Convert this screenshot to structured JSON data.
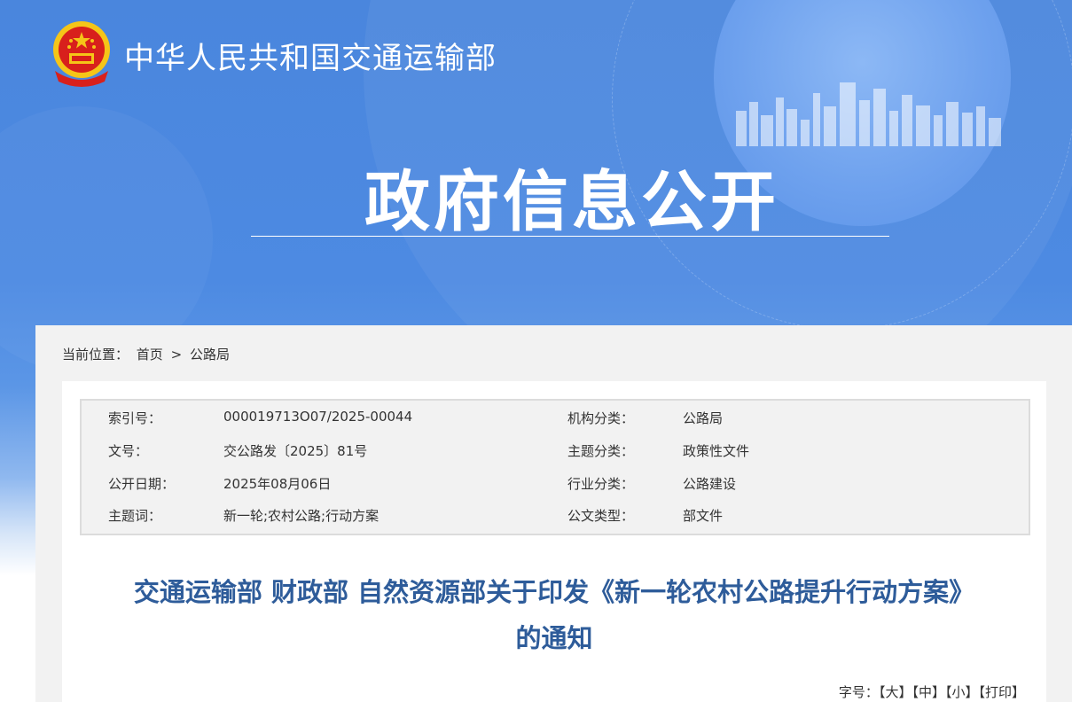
{
  "header": {
    "ministry_name": "中华人民共和国交通运输部",
    "section_title": "政府信息公开"
  },
  "breadcrumb": {
    "prefix": "当前位置：",
    "home": "首页",
    "separator": ">",
    "current": "公路局"
  },
  "meta": {
    "rows": [
      {
        "label1": "索引号：",
        "value1": "000019713O07/2025-00044",
        "label2": "机构分类：",
        "value2": "公路局"
      },
      {
        "label1": "文号：",
        "value1": "交公路发〔2025〕81号",
        "label2": "主题分类：",
        "value2": "政策性文件"
      },
      {
        "label1": "公开日期：",
        "value1": "2025年08月06日",
        "label2": "行业分类：",
        "value2": "公路建设"
      },
      {
        "label1": "主题词：",
        "value1": "新一轮;农村公路;行动方案",
        "label2": "公文类型：",
        "value2": "部文件"
      }
    ]
  },
  "document": {
    "title_line1": "交通运输部 财政部 自然资源部关于印发《新一轮农村公路提升行动方案》",
    "title_line2": "的通知"
  },
  "font_controls": {
    "label": "字号：",
    "large": "【大】",
    "medium": "【中】",
    "small": "【小】",
    "print": "【打印】"
  },
  "colors": {
    "banner_blue": "#4a86dd",
    "title_blue": "#2e5c9a",
    "emblem_red": "#d8201c",
    "emblem_gold": "#f5c518"
  }
}
